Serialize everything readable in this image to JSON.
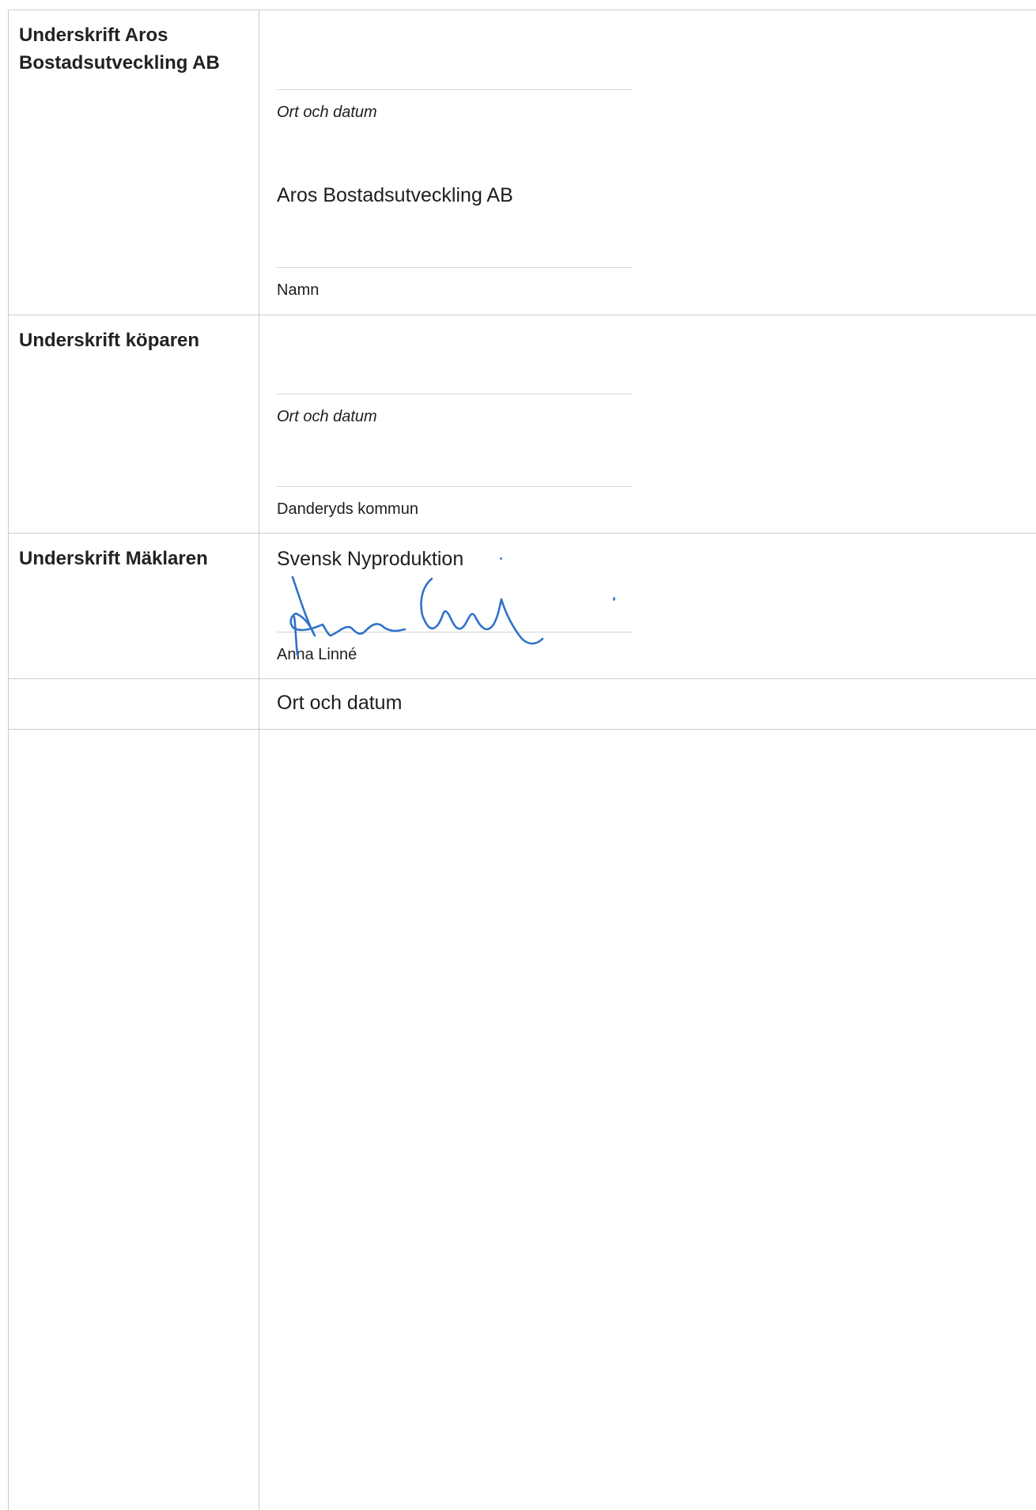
{
  "rows": [
    {
      "label_line1": "Underskrift Aros",
      "label_line2": "Bostadsutveckling AB",
      "place_date_label": "Ort och datum",
      "company_name": "Aros Bostadsutveckling AB",
      "name_label": "Namn"
    },
    {
      "label": "Underskrift köparen",
      "place_date_label": "Ort och datum",
      "buyer_name": "Danderyds kommun"
    },
    {
      "label": "Underskrift Mäklaren",
      "company_name": "Svensk Nyproduktion",
      "signer_name": "Anna Linné",
      "place_date_label": "Ort och datum"
    }
  ],
  "colors": {
    "signature_ink": "#2f73c9",
    "grid": "#c9c9c9"
  }
}
